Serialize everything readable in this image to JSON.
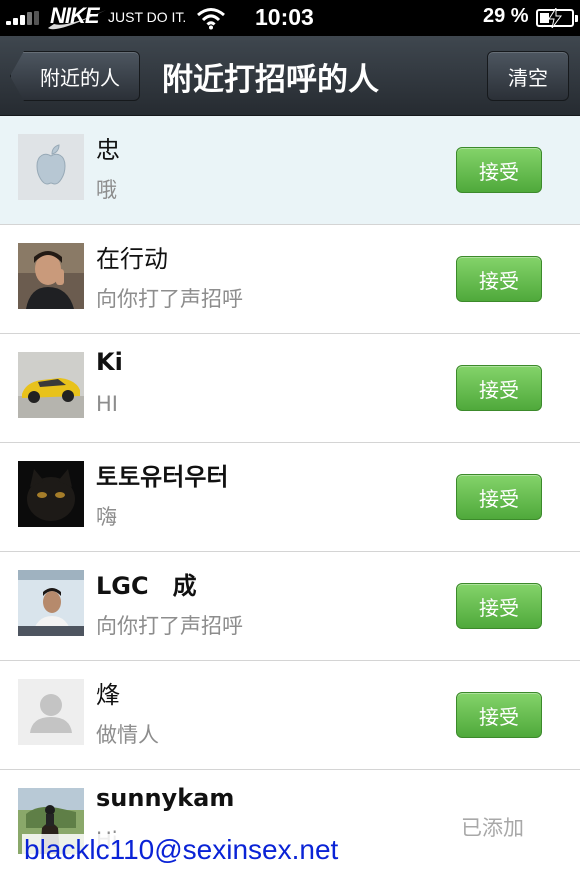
{
  "status_bar": {
    "carrier_logo": "NIKE",
    "carrier_text": "JUST DO IT.",
    "time": "10:03",
    "battery_percent": "29 %",
    "battery_level": 0.29,
    "icons": [
      "signal-icon",
      "wifi-icon",
      "battery-icon"
    ]
  },
  "nav": {
    "back_label": "附近的人",
    "title": "附近打招呼的人",
    "clear_label": "清空"
  },
  "rows": [
    {
      "name": "忠",
      "message": "哦",
      "action": "接受",
      "avatar": "apple-logo"
    },
    {
      "name": "在行动",
      "message": "向你打了声招呼",
      "action": "接受",
      "avatar": "man-on-phone"
    },
    {
      "name": "Ki",
      "message": "HI",
      "action": "接受",
      "avatar": "yellow-car"
    },
    {
      "name": "토토유터우터",
      "message": "嗨",
      "action": "接受",
      "avatar": "black-cat"
    },
    {
      "name": "LGC　成",
      "message": "向你打了声招呼",
      "action": "接受",
      "avatar": "man-at-desk"
    },
    {
      "name": "烽",
      "message": "做情人",
      "action": "接受",
      "avatar": "default-person"
    },
    {
      "name": "sunnykam",
      "message": "Hi",
      "status": "已添加",
      "avatar": "horse-rider"
    }
  ],
  "watermark": "blacklc110@sexinsex.net",
  "colors": {
    "nav_bar": "#2f353c",
    "accept_green": "#5db547",
    "highlight_row": "#eaf4f7",
    "watermark": "#0a23d6"
  }
}
